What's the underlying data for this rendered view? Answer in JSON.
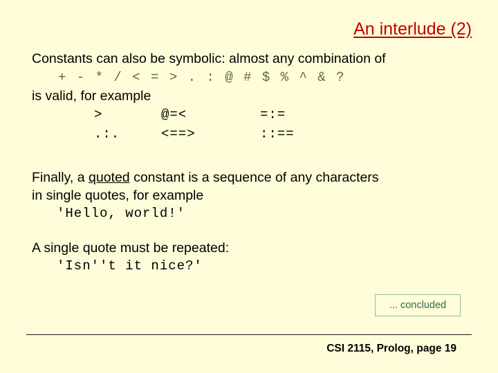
{
  "slide": {
    "title": "An interlude (2)",
    "title_color": "#c00000",
    "background_color": "#fffcd9"
  },
  "body": {
    "intro_line": "Constants can also be symbolic: almost any combination of",
    "operator_charset": "+ - * / < = > . : @ # $ % ^ & ?",
    "operator_charset_color": "#5f6b2a",
    "valid_line": "is valid, for example",
    "examples": [
      {
        "col1": ">",
        "col2": "@=<",
        "col3": "=:="
      },
      {
        "col1": ".:.",
        "col2": "<==>",
        "col3": "::=="
      }
    ],
    "quoted_paragraph": {
      "before": "Finally, a ",
      "emphasis": "quoted",
      "after": " constant is a sequence of any characters",
      "line2": "in single quotes, for example"
    },
    "hello_example": "'Hello, world!'",
    "repeat_line": "A single quote must be repeated:",
    "isnt_example": "'Isn''t it nice?'"
  },
  "concluded": {
    "label": "... concluded",
    "border_color": "#8fbf9f",
    "text_color": "#2f6b52"
  },
  "footer": {
    "text": "CSI 2115, Prolog, page 19"
  }
}
